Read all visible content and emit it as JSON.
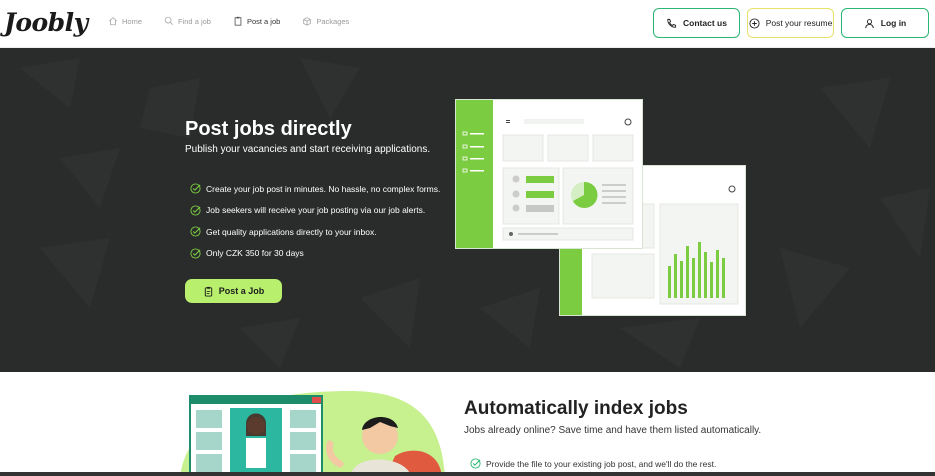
{
  "header": {
    "logo": "Joobly",
    "nav": [
      {
        "label": "Home",
        "icon": "home-icon"
      },
      {
        "label": "Find a job",
        "icon": "search-person-icon"
      },
      {
        "label": "Post a job",
        "icon": "clipboard-icon"
      },
      {
        "label": "Packages",
        "icon": "package-icon"
      }
    ],
    "contact_label": "Contact us",
    "resume_label": "Post your resume",
    "login_label": "Log in"
  },
  "hero": {
    "title": "Post jobs directly",
    "subtitle": "Publish your vacancies and start receiving applications.",
    "benefits": [
      "Create your job post in minutes. No hassle, no complex forms.",
      "Job seekers will receive your job posting via our job alerts.",
      "Get quality applications directly to your inbox.",
      "Only CZK 350 for 30 days"
    ],
    "cta_label": "Post a Job"
  },
  "section2": {
    "title": "Automatically index jobs",
    "subtitle": "Jobs already online? Save time and have them listed automatically.",
    "benefit": "Provide the file to your existing job post, and we'll do the rest."
  },
  "colors": {
    "accent_green": "#2bb673",
    "cta_green": "#b8ef6d",
    "hero_bg": "#2a2c2b",
    "mock_green": "#7ccc42"
  }
}
